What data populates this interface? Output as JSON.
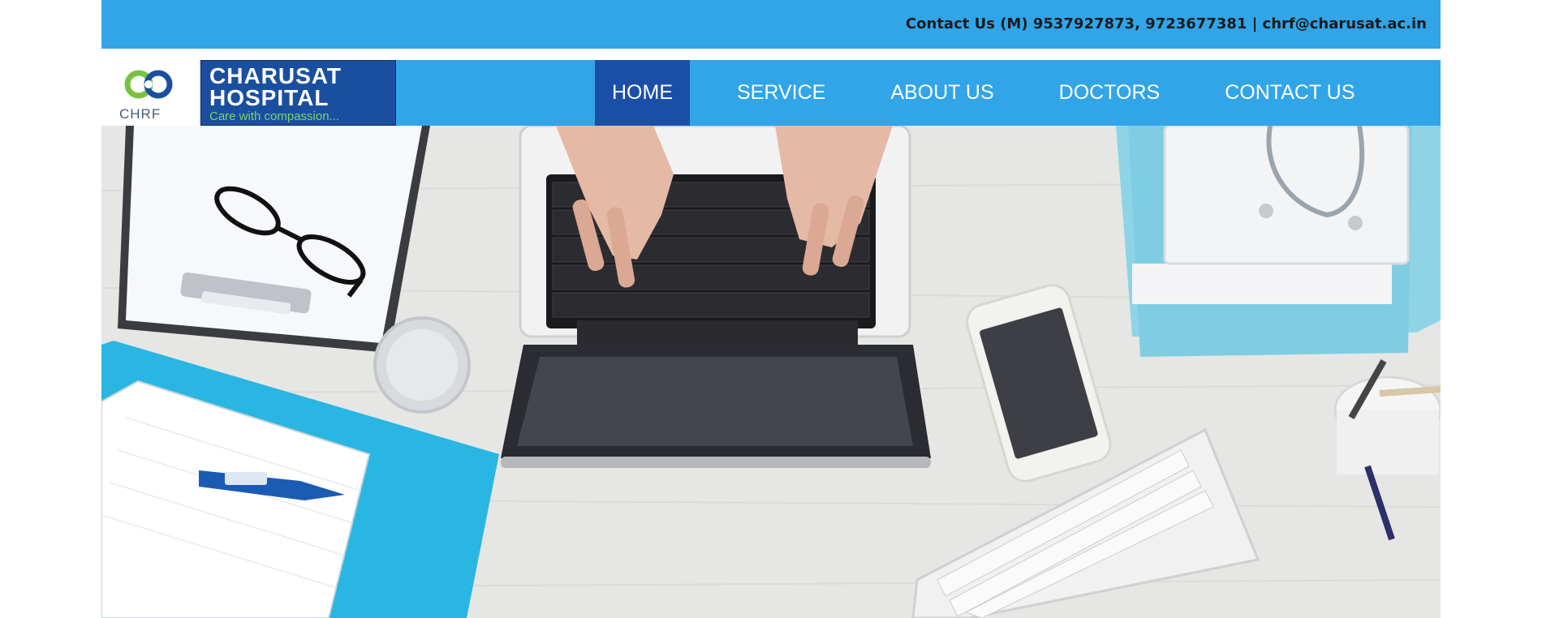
{
  "topbar": {
    "contact_text": "Contact Us (M) 9537927873, 9723677381 | chrf@charusat.ac.in"
  },
  "logo": {
    "mark_text": "CHRF",
    "brand_line1": "CHARUSAT",
    "brand_line2": "HOSPITAL",
    "tagline": "Care with compassion..."
  },
  "nav": {
    "items": [
      {
        "label": "HOME",
        "active": true
      },
      {
        "label": "SERVICE",
        "active": false
      },
      {
        "label": "ABOUT US",
        "active": false
      },
      {
        "label": "DOCTORS",
        "active": false
      },
      {
        "label": "CONTACT US",
        "active": false
      }
    ]
  },
  "hero": {
    "scene_items": [
      "clipboard-icon",
      "glasses-icon",
      "laptop-icon",
      "typing-hands-icon",
      "stethoscope-icon",
      "phone-icon",
      "water-glass-icon",
      "notepad-icon",
      "thermometer-icon",
      "keyboard-icon",
      "pen-cup-icon"
    ]
  },
  "colors": {
    "accent": "#31a5e8",
    "nav_active": "#1a4fa8",
    "brand_blue": "#1a4fa0"
  }
}
